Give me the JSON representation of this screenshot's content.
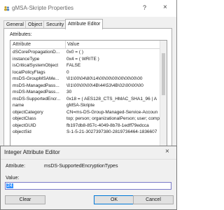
{
  "properties_window": {
    "title": "gMSA-Skripte Properties",
    "help_label": "?",
    "close_label": "×",
    "tabs": [
      {
        "label": "General"
      },
      {
        "label": "Object"
      },
      {
        "label": "Security"
      },
      {
        "label": "Attribute Editor"
      }
    ],
    "attributes_label": "Attributes:",
    "columns": {
      "attribute": "Attribute",
      "value": "Value"
    },
    "rows": [
      {
        "attribute": "dSCorePropagationD...",
        "value": "0x0 = ( )"
      },
      {
        "attribute": "instanceType",
        "value": "0x4 = ( WRITE )"
      },
      {
        "attribute": "isCriticalSystemObject",
        "value": "FALSE"
      },
      {
        "attribute": "localPolicyFlags",
        "value": "0"
      },
      {
        "attribute": "msDS-GroupMSAMe...",
        "value": "\\01\\00\\04\\80\\14\\00\\00\\00\\00\\00\\00\\00"
      },
      {
        "attribute": "msDS-ManagedPass...",
        "value": "\\01\\00\\00\\00\\4B\\44\\53\\4B\\02\\00\\00\\00"
      },
      {
        "attribute": "msDS-ManagedPass...",
        "value": "30"
      },
      {
        "attribute": "msDS-SupportedEncr...",
        "value": "0x18 = ( AES128_CTS_HMAC_SHA1_96 | A"
      },
      {
        "attribute": "name",
        "value": "gMSA-Skripte"
      },
      {
        "attribute": "objectCategory",
        "value": "CN=ms-DS-Group-Managed-Service-Accoun"
      },
      {
        "attribute": "objectClass",
        "value": "top; person; organizationalPerson; user; comp"
      },
      {
        "attribute": "objectGUID",
        "value": "fb197db8-857c-4049-8b78-1edff79edcca"
      },
      {
        "attribute": "objectSid",
        "value": "S-1-5-21-3027397380-2819736464-1836607"
      }
    ]
  },
  "integer_editor": {
    "title": "Integer Attribute Editor",
    "close_label": "×",
    "attribute_label": "Attribute:",
    "attribute_value": "msDS-SupportedEncryptionTypes",
    "value_label": "Value:",
    "value": "24",
    "buttons": {
      "clear": "Clear",
      "ok": "OK",
      "cancel": "Cancel"
    }
  }
}
